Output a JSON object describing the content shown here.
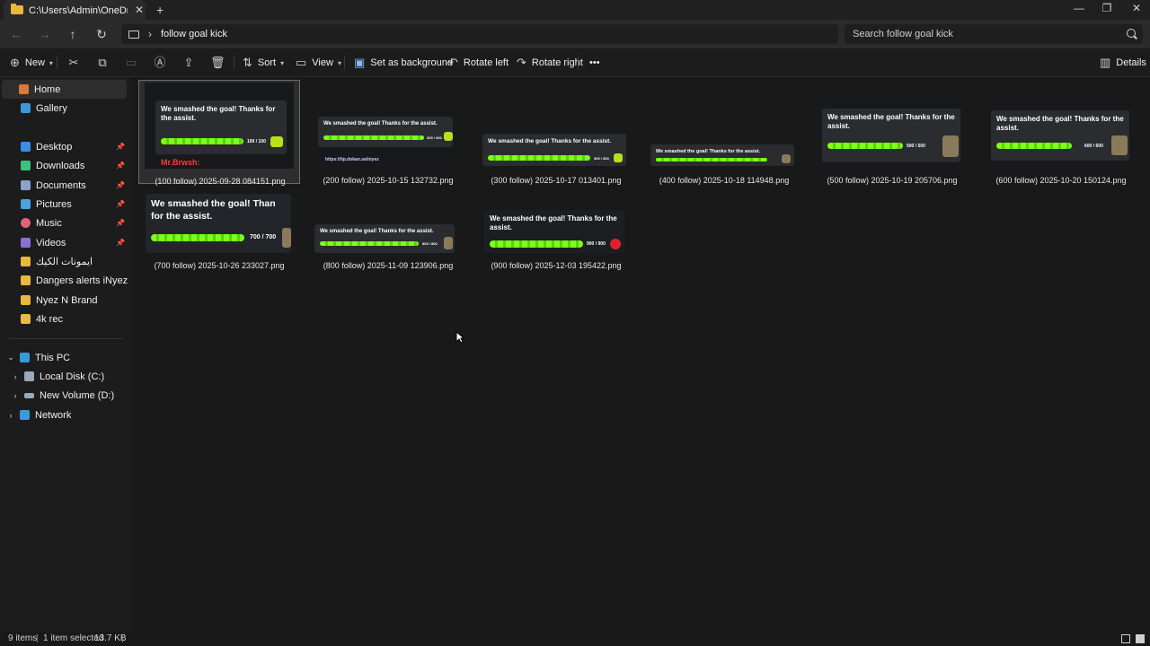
{
  "window": {
    "tab_title": "C:\\Users\\Admin\\OneDrive\\تب",
    "tab_close": "✕",
    "tab_add": "+",
    "minimize": "—",
    "maximize": "❐",
    "close": "✕"
  },
  "address": {
    "back": "←",
    "forward": "→",
    "up": "↑",
    "refresh": "↻",
    "separator": "›",
    "crumb": "follow goal kick",
    "search_placeholder": "Search follow goal kick"
  },
  "toolbar": {
    "new_label": "New",
    "sort_label": "Sort",
    "view_label": "View",
    "set_background_label": "Set as background",
    "rotate_left_label": "Rotate left",
    "rotate_right_label": "Rotate right",
    "more_label": "•••",
    "details_label": "Details",
    "icons": [
      "new-icon",
      "cut-icon",
      "copy-icon",
      "paste-icon",
      "rename-icon",
      "share-icon",
      "delete-icon",
      "sort-icon",
      "view-icon",
      "set-background-icon",
      "rotate-left-icon",
      "rotate-right-icon",
      "details-icon"
    ]
  },
  "sidebar": {
    "home": "Home",
    "gallery": "Gallery",
    "quick_access": [
      {
        "label": "Desktop",
        "icon": "desktop-icon",
        "color": "#3a8ee6"
      },
      {
        "label": "Downloads",
        "icon": "downloads-icon",
        "color": "#3fbf7f"
      },
      {
        "label": "Documents",
        "icon": "documents-icon",
        "color": "#8aa4c8"
      },
      {
        "label": "Pictures",
        "icon": "pictures-icon",
        "color": "#4aa3df"
      },
      {
        "label": "Music",
        "icon": "music-icon",
        "color": "#e0607e"
      },
      {
        "label": "Videos",
        "icon": "videos-icon",
        "color": "#8b6fd6"
      },
      {
        "label": "ايمونات الكيك",
        "icon": "folder-icon",
        "color": "#e8b93b"
      },
      {
        "label": "Dangers alerts iNyez",
        "icon": "folder-icon",
        "color": "#e8b93b"
      },
      {
        "label": "Nyez N Brand",
        "icon": "folder-icon",
        "color": "#e8b93b"
      },
      {
        "label": "4k rec",
        "icon": "folder-icon",
        "color": "#e8b93b"
      }
    ],
    "this_pc": "This PC",
    "local_disk": "Local Disk (C:)",
    "new_volume": "New Volume (D:)",
    "network": "Network"
  },
  "files": [
    {
      "name": "(100 follow) 2025-09-28 084151.png",
      "count": "100 / 100",
      "selected": true
    },
    {
      "name": "(200 follow) 2025-10-15 132732.png",
      "count": "200 / 200",
      "selected": false
    },
    {
      "name": "(300 follow) 2025-10-17 013401.png",
      "count": "300 / 300",
      "selected": false
    },
    {
      "name": "(400 follow) 2025-10-18 114948.png",
      "count": "",
      "selected": false
    },
    {
      "name": "(500 follow) 2025-10-19 205706.png",
      "count": "500 / 500",
      "selected": false
    },
    {
      "name": "(600 follow) 2025-10-20 150124.png",
      "count": "600 / 600",
      "selected": false
    },
    {
      "name": "(700 follow) 2025-10-26 233027.png",
      "count": "700 / 700",
      "selected": false
    },
    {
      "name": "(800 follow) 2025-11-09 123906.png",
      "count": "800 / 800",
      "selected": false
    },
    {
      "name": "(900 follow) 2025-12-03 195422.png",
      "count": "900 / 900",
      "selected": false
    }
  ],
  "thumb_text": {
    "message": "We smashed the goal! Thanks for the assist.",
    "message_cut": "We smashed the goal! Than",
    "message_cut_2": "for the assist.",
    "user_name": "Mr.Brwsh:",
    "tip_link": "https://tip.dokan.sa/inyez"
  },
  "status": {
    "items": "9 items",
    "selected": "1 item selected",
    "size": "13.7 KB"
  }
}
